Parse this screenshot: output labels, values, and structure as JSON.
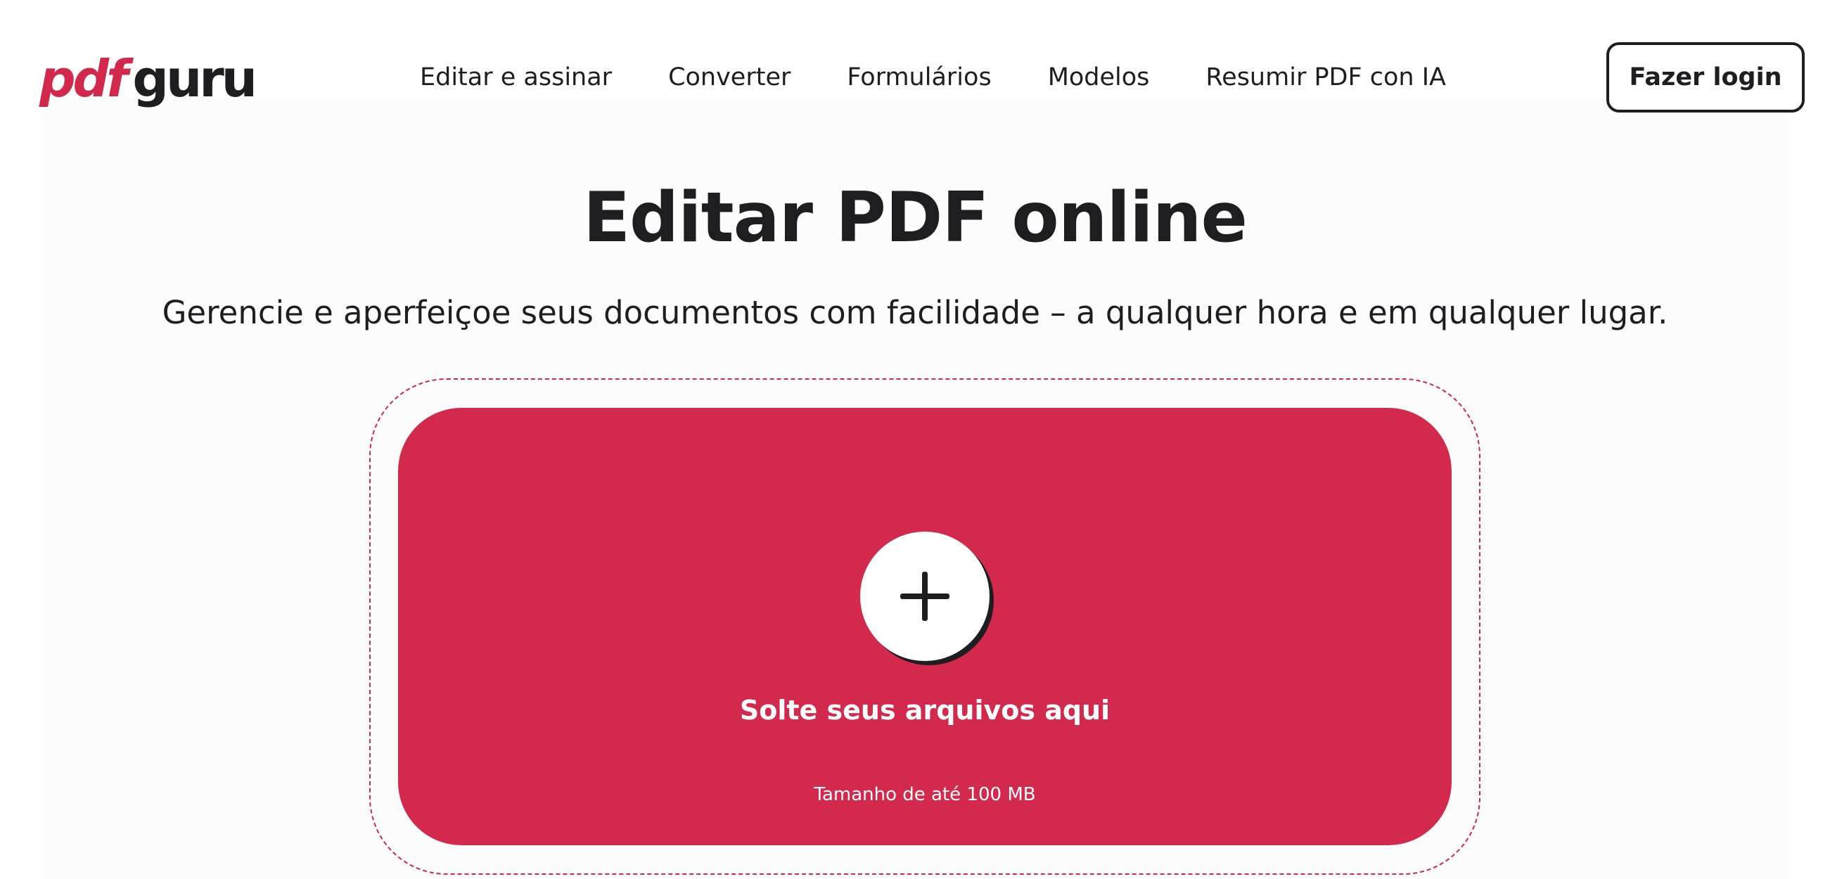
{
  "brand": {
    "logo_part1": "pdf",
    "logo_part2": "guru",
    "accent_color": "#d2284b",
    "text_color": "#1e1e22"
  },
  "nav": {
    "items": [
      {
        "label": "Editar e assinar"
      },
      {
        "label": "Converter"
      },
      {
        "label": "Formulários"
      },
      {
        "label": "Modelos"
      },
      {
        "label": "Resumir PDF con IA"
      }
    ]
  },
  "header": {
    "login_label": "Fazer login"
  },
  "hero": {
    "title": "Editar PDF online",
    "subtitle": "Gerencie e aperfeiçoe seus documentos com facilidade – a qualquer hora e em qualquer lugar."
  },
  "dropzone": {
    "icon": "plus-icon",
    "label": "Solte seus arquivos aqui",
    "size_note": "Tamanho de até 100 MB"
  }
}
